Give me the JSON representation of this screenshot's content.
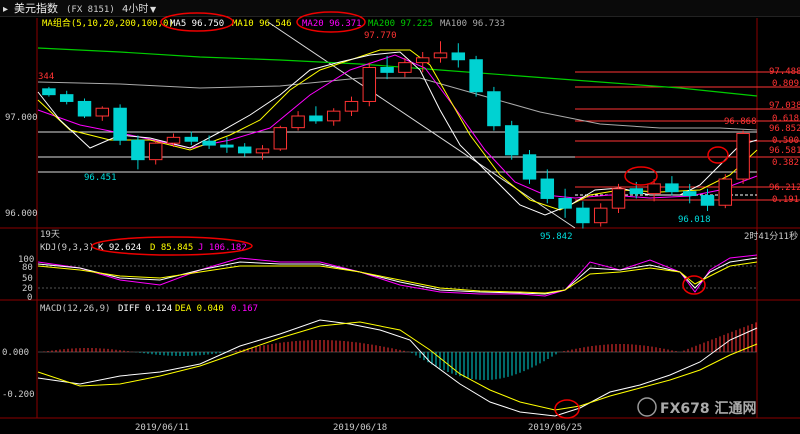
{
  "header": {
    "symbol": "美元指数",
    "code": "(FX 8151)",
    "period": "4小时",
    "period_arrow": "▼"
  },
  "price_panel": {
    "ma_label": "MA组合(5,10,20,200,100,0)",
    "ma5": "MA5 96.750",
    "ma10": "MA10 96.546",
    "ma20": "MA20 96.371",
    "ma200": "MA200 97.225",
    "ma100": "MA100 96.733",
    "y_ticks": [
      "97.000",
      "96.000"
    ],
    "annotations": {
      "high_left": "344",
      "peak": "97.770",
      "low1": "96.451",
      "low2": "95.842",
      "low3": "96.018",
      "last_high": "96.868"
    },
    "fib_levels": [
      "97.488",
      "0.809",
      "97.038",
      "0.618",
      "96.852",
      "0.500",
      "96.581",
      "0.382",
      "96.212",
      "0.191"
    ],
    "count_label": "19天",
    "countdown": "2时41分11秒",
    "colors": {
      "up": "#ff3333",
      "down": "#00d2d2",
      "ma5": "#ffffff",
      "ma10": "#ffff00",
      "ma20": "#ff00ff",
      "ma200": "#00cc00",
      "ma100": "#aaaaaa",
      "fib": "#ff3333"
    }
  },
  "kdj_panel": {
    "label": "KDJ(9,3,3)",
    "k": "K 92.624",
    "d": "D 85.845",
    "j": "J 106.182",
    "y_ticks": [
      "100",
      "80",
      "50",
      "20",
      "0"
    ]
  },
  "macd_panel": {
    "label": "MACD(12,26,9)",
    "diff": "DIFF 0.124",
    "dea": "DEA 0.040",
    "macd": "0.167",
    "y_ticks": [
      "0.000",
      "-0.200"
    ]
  },
  "x_axis": {
    "dates": [
      "2019/06/11",
      "2019/06/18",
      "2019/06/25"
    ]
  },
  "watermark": "FX678 汇通网",
  "chart_data": {
    "type": "candlestick",
    "price_start": 97.27,
    "closes_description": "4-hour candles; prices read from chart",
    "candles": [
      [
        97.28,
        97.3,
        97.2,
        97.22
      ],
      [
        97.22,
        97.26,
        97.12,
        97.15
      ],
      [
        97.15,
        97.18,
        96.98,
        97.0
      ],
      [
        97.0,
        97.1,
        96.95,
        97.08
      ],
      [
        97.08,
        97.12,
        96.7,
        96.75
      ],
      [
        96.75,
        96.8,
        96.45,
        96.55
      ],
      [
        96.55,
        96.75,
        96.5,
        96.72
      ],
      [
        96.72,
        96.82,
        96.68,
        96.78
      ],
      [
        96.78,
        96.84,
        96.7,
        96.74
      ],
      [
        96.74,
        96.8,
        96.66,
        96.7
      ],
      [
        96.7,
        96.78,
        96.62,
        96.68
      ],
      [
        96.68,
        96.72,
        96.58,
        96.62
      ],
      [
        96.62,
        96.7,
        96.55,
        96.66
      ],
      [
        96.66,
        96.9,
        96.64,
        96.88
      ],
      [
        96.88,
        97.05,
        96.85,
        97.0
      ],
      [
        97.0,
        97.1,
        96.92,
        96.95
      ],
      [
        96.95,
        97.08,
        96.9,
        97.05
      ],
      [
        97.05,
        97.2,
        97.0,
        97.15
      ],
      [
        97.15,
        97.55,
        97.1,
        97.5
      ],
      [
        97.5,
        97.62,
        97.38,
        97.45
      ],
      [
        97.45,
        97.6,
        97.4,
        97.55
      ],
      [
        97.55,
        97.66,
        97.45,
        97.6
      ],
      [
        97.6,
        97.77,
        97.55,
        97.65
      ],
      [
        97.65,
        97.75,
        97.5,
        97.58
      ],
      [
        97.58,
        97.62,
        97.2,
        97.25
      ],
      [
        97.25,
        97.3,
        96.85,
        96.9
      ],
      [
        96.9,
        96.95,
        96.55,
        96.6
      ],
      [
        96.6,
        96.65,
        96.3,
        96.35
      ],
      [
        96.35,
        96.45,
        96.1,
        96.15
      ],
      [
        96.15,
        96.25,
        95.95,
        96.05
      ],
      [
        96.05,
        96.12,
        95.84,
        95.9
      ],
      [
        95.9,
        96.1,
        95.86,
        96.05
      ],
      [
        96.05,
        96.3,
        96.0,
        96.25
      ],
      [
        96.25,
        96.32,
        96.15,
        96.2
      ],
      [
        96.2,
        96.35,
        96.12,
        96.3
      ],
      [
        96.3,
        96.38,
        96.18,
        96.22
      ],
      [
        96.22,
        96.3,
        96.1,
        96.18
      ],
      [
        96.18,
        96.25,
        96.02,
        96.08
      ],
      [
        96.08,
        96.4,
        96.05,
        96.35
      ],
      [
        96.35,
        96.85,
        96.3,
        96.82
      ]
    ],
    "title": "",
    "xlabel": "",
    "ylabel": ""
  }
}
